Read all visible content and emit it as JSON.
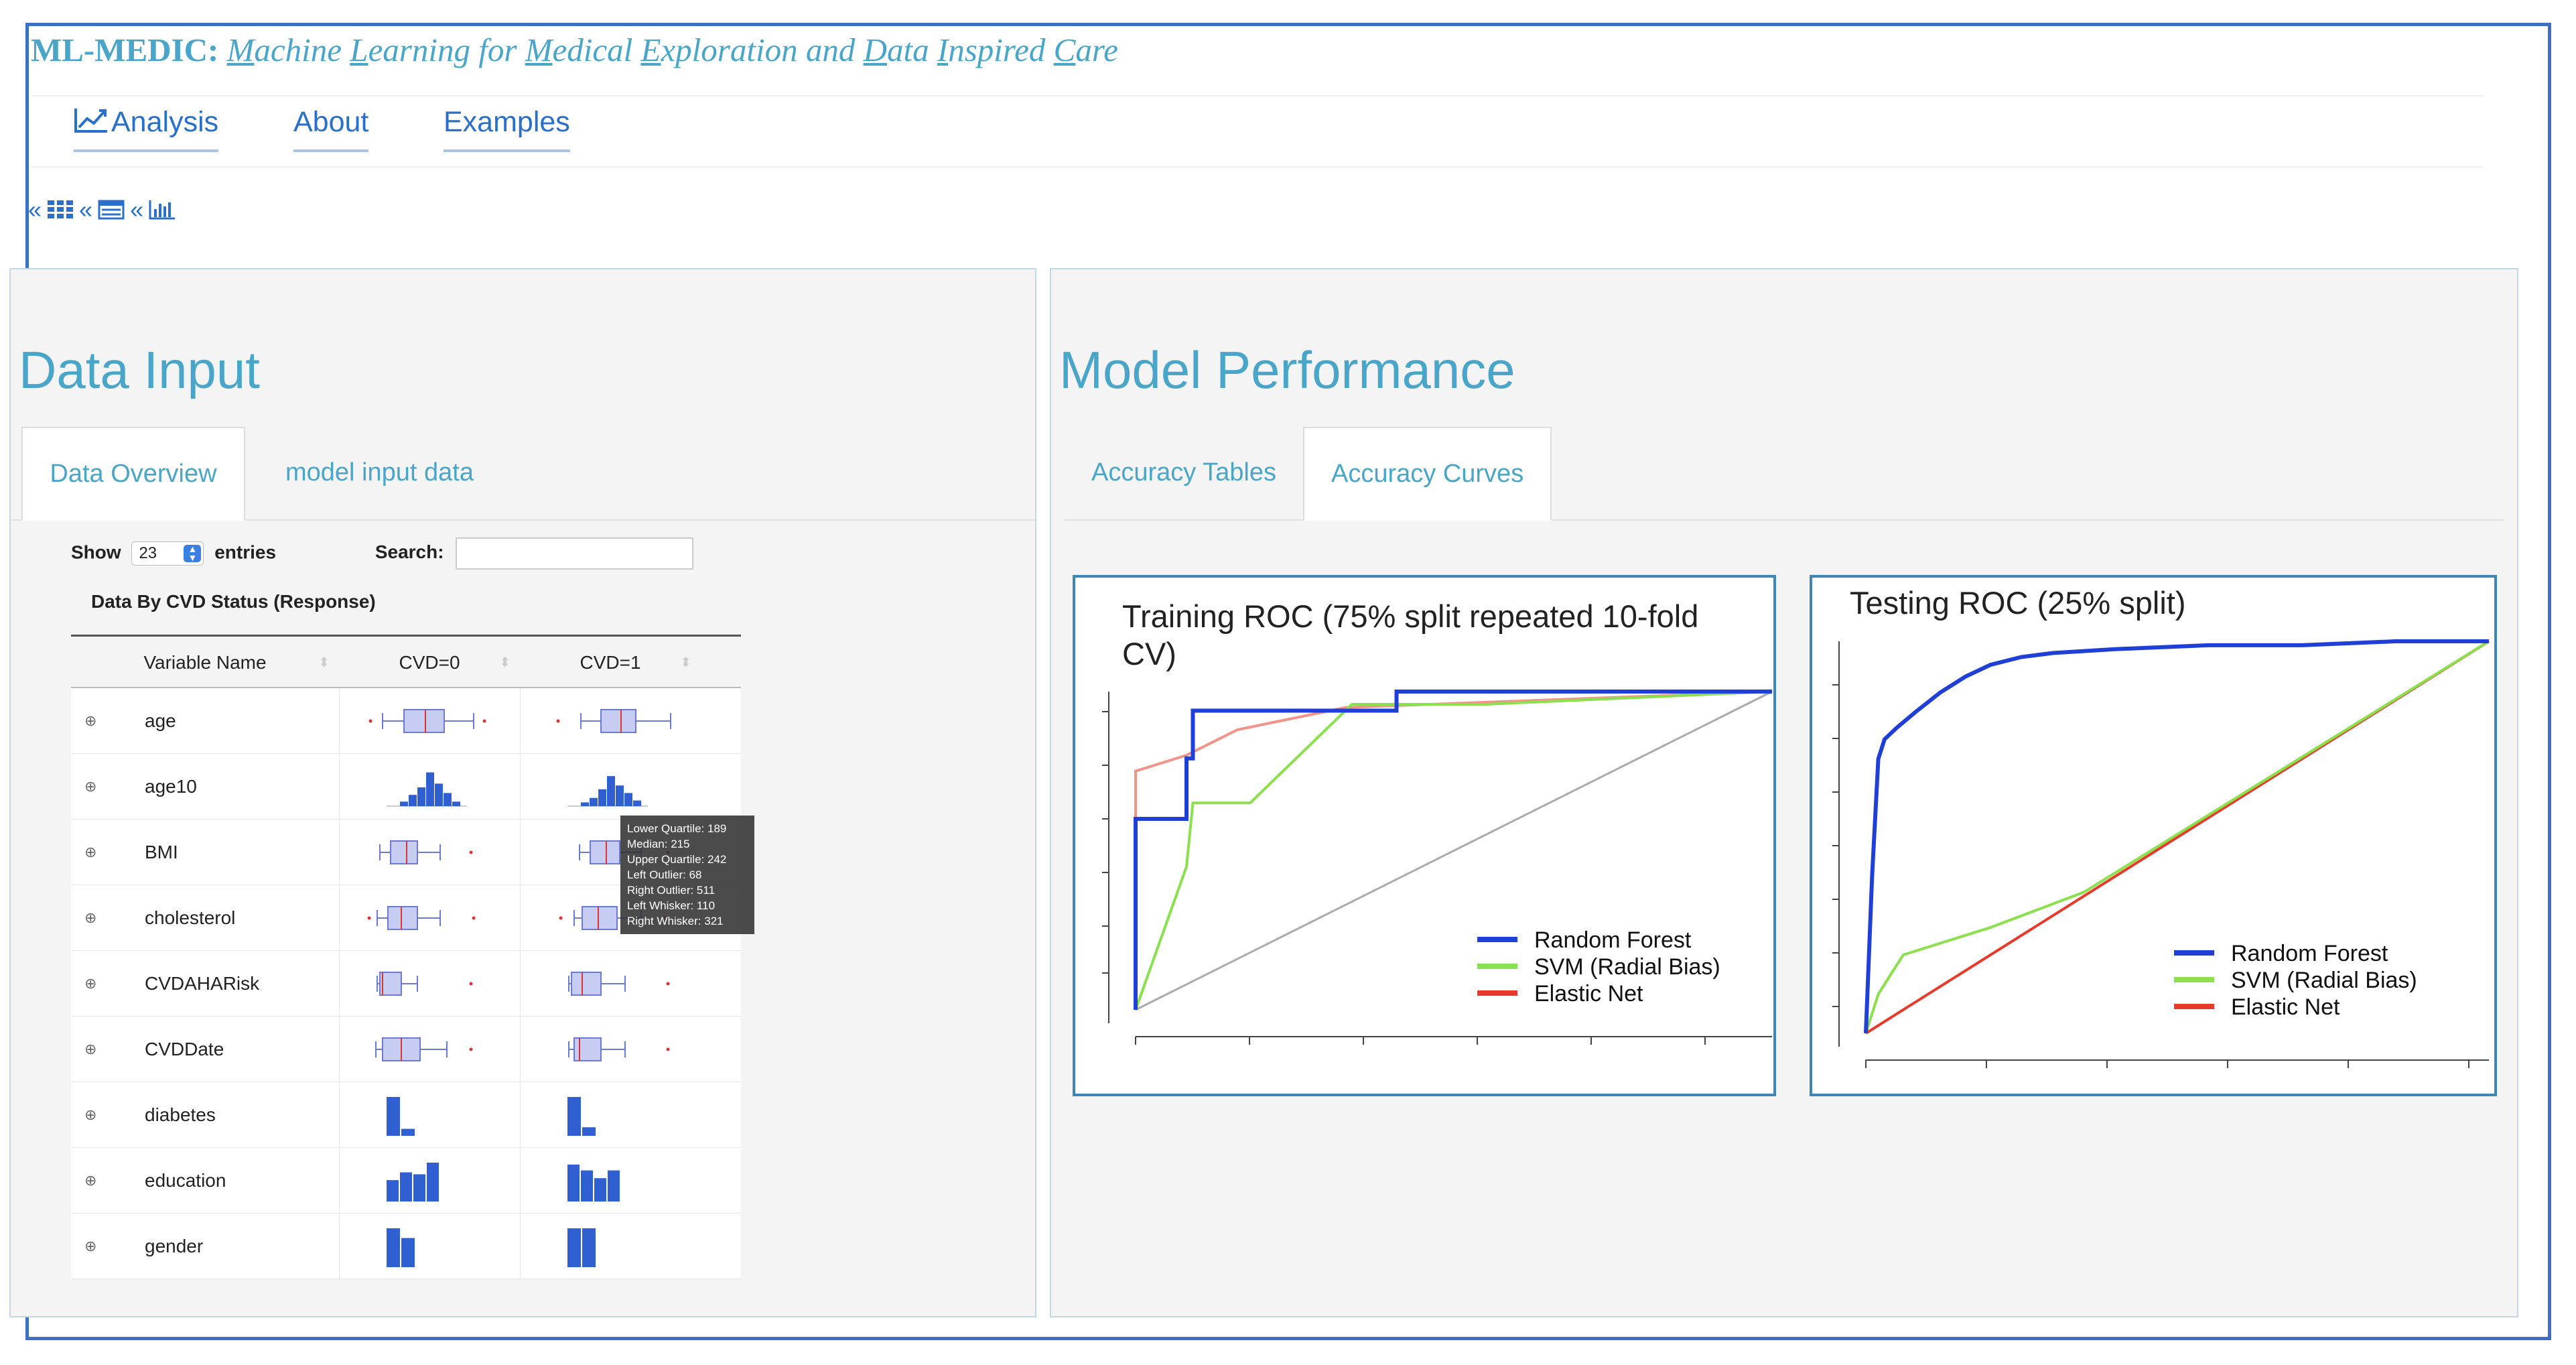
{
  "app": {
    "brand_title": "ML-MEDIC:",
    "brand_words": [
      {
        "initial": "M",
        "rest": "achine"
      },
      {
        "initial": "L",
        "rest": "earning"
      },
      {
        "plain": "for"
      },
      {
        "initial": "M",
        "rest": "edical"
      },
      {
        "initial": "E",
        "rest": "xploration"
      },
      {
        "plain": "and"
      },
      {
        "initial": "D",
        "rest": "ata"
      },
      {
        "initial": "I",
        "rest": "nspired"
      },
      {
        "initial": "C",
        "rest": "are"
      }
    ]
  },
  "nav": {
    "items": [
      {
        "label": "Analysis",
        "icon": "line-chart-icon"
      },
      {
        "label": "About"
      },
      {
        "label": "Examples"
      }
    ]
  },
  "breadcrumb": {
    "sep": "«",
    "icons": [
      "grid-icon",
      "table-icon",
      "bar-chart-icon"
    ]
  },
  "left_panel": {
    "title": "Data Input",
    "tabs": [
      {
        "label": "Data Overview",
        "active": true
      },
      {
        "label": "model input data",
        "active": false
      }
    ],
    "show_label": "Show",
    "show_value": "23",
    "entries_label": "entries",
    "search_label": "Search:",
    "search_value": "",
    "table_caption": "Data By CVD Status (Response)",
    "columns": [
      "Variable Name",
      "CVD=0",
      "CVD=1"
    ],
    "rows": [
      {
        "name": "age",
        "kind": "box"
      },
      {
        "name": "age10",
        "kind": "hist"
      },
      {
        "name": "BMI",
        "kind": "box"
      },
      {
        "name": "cholesterol",
        "kind": "box"
      },
      {
        "name": "CVDAHARisk",
        "kind": "box"
      },
      {
        "name": "CVDDate",
        "kind": "box"
      },
      {
        "name": "diabetes",
        "kind": "bar"
      },
      {
        "name": "education",
        "kind": "bar"
      },
      {
        "name": "gender",
        "kind": "bar"
      }
    ],
    "tooltip": [
      "Lower Quartile: 189",
      "Median: 215",
      "Upper Quartile: 242",
      "Left Outlier: 68",
      "Right Outlier: 511",
      "Left Whisker: 110",
      "Right Whisker: 321"
    ]
  },
  "right_panel": {
    "title": "Model Performance",
    "tabs": [
      {
        "label": "Accuracy Tables",
        "active": false
      },
      {
        "label": "Accuracy Curves",
        "active": true
      }
    ]
  },
  "colors": {
    "random_forest": "#1f3fd6",
    "svm": "#8be04e",
    "elastic_net": "#e83a2a",
    "accent": "#4aa6c9",
    "link": "#2a6fc9"
  },
  "chart_data": [
    {
      "type": "line",
      "title": "Training ROC (75% split repeated 10-fold CV)",
      "xlim": [
        0,
        1
      ],
      "ylim": [
        0,
        1
      ],
      "series": [
        {
          "name": "Random Forest",
          "color": "#1f3fd6",
          "x": [
            0,
            0,
            0.08,
            0.08,
            0.09,
            0.09,
            0.41,
            0.41,
            1
          ],
          "y": [
            0,
            0.6,
            0.6,
            0.79,
            0.79,
            0.94,
            0.94,
            1,
            1
          ]
        },
        {
          "name": "SVM (Radial Bias)",
          "color": "#8be04e",
          "x": [
            0,
            0.08,
            0.09,
            0.18,
            0.34,
            0.55,
            1
          ],
          "y": [
            0,
            0.45,
            0.65,
            0.65,
            0.96,
            0.96,
            1
          ]
        },
        {
          "name": "Elastic Net",
          "color": "#e83a2a",
          "x": [
            0,
            0,
            0.08,
            0.16,
            0.33,
            1
          ],
          "y": [
            0,
            0.75,
            0.8,
            0.88,
            0.95,
            1
          ]
        }
      ],
      "reference": {
        "x": [
          0,
          1
        ],
        "y": [
          0,
          1
        ]
      },
      "legend": "bottom-right"
    },
    {
      "type": "line",
      "title": "Testing ROC (25% split)",
      "xlim": [
        0,
        1
      ],
      "ylim": [
        0,
        1
      ],
      "series": [
        {
          "name": "Random Forest",
          "color": "#1f3fd6",
          "x": [
            0,
            0.01,
            0.02,
            0.03,
            0.05,
            0.08,
            0.12,
            0.16,
            0.2,
            0.25,
            0.3,
            0.4,
            0.55,
            0.7,
            0.85,
            1
          ],
          "y": [
            0,
            0.4,
            0.7,
            0.75,
            0.78,
            0.82,
            0.87,
            0.91,
            0.94,
            0.96,
            0.97,
            0.98,
            0.99,
            0.99,
            1,
            1
          ]
        },
        {
          "name": "SVM (Radial Bias)",
          "color": "#8be04e",
          "x": [
            0,
            0.02,
            0.06,
            0.2,
            0.35,
            1
          ],
          "y": [
            0,
            0.1,
            0.2,
            0.27,
            0.36,
            1
          ]
        },
        {
          "name": "Elastic Net",
          "color": "#e83a2a",
          "x": [
            0,
            1
          ],
          "y": [
            0,
            1
          ]
        }
      ],
      "legend": "bottom-right"
    }
  ]
}
